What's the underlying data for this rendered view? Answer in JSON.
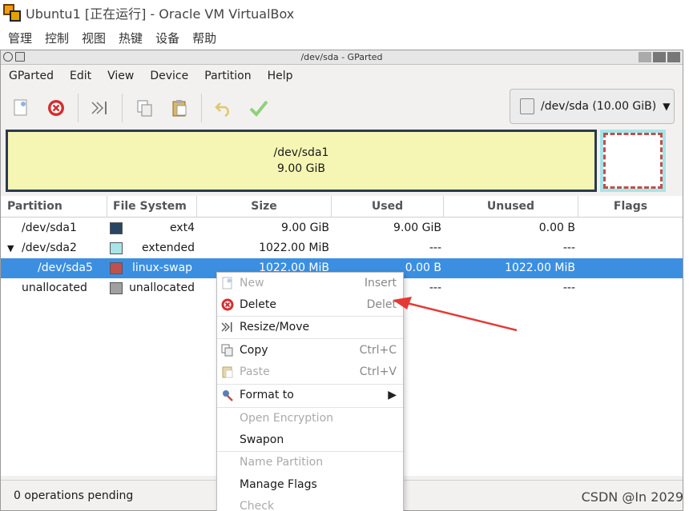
{
  "host": {
    "title": "Ubuntu1 [正在运行] - Oracle VM VirtualBox",
    "menu": [
      "管理",
      "控制",
      "视图",
      "热键",
      "设备",
      "帮助"
    ]
  },
  "guest": {
    "title": "/dev/sda - GParted",
    "menu": [
      "GParted",
      "Edit",
      "View",
      "Device",
      "Partition",
      "Help"
    ],
    "device_selector": "/dev/sda (10.00 GiB)"
  },
  "partition_bar": {
    "p1_name": "/dev/sda1",
    "p1_size": "9.00 GiB"
  },
  "table": {
    "headers": [
      "Partition",
      "File System",
      "Size",
      "Used",
      "Unused",
      "Flags"
    ],
    "rows": [
      {
        "partition": "/dev/sda1",
        "fs": "ext4",
        "size": "9.00 GiB",
        "used": "9.00 GiB",
        "unused": "0.00 B",
        "color": "#2a4564"
      },
      {
        "partition": "/dev/sda2",
        "fs": "extended",
        "size": "1022.00 MiB",
        "used": "---",
        "unused": "---",
        "color": "#a7e5e7"
      },
      {
        "partition": "/dev/sda5",
        "fs": "linux-swap",
        "size": "1022.00 MiB",
        "used": "0.00 B",
        "unused": "1022.00 MiB",
        "color": "#c0504d"
      },
      {
        "partition": "unallocated",
        "fs": "unallocated",
        "size": "",
        "used": "",
        "unused": "---",
        "color": "#a0a0a0"
      }
    ],
    "sda2_flags": "---",
    "unalloc_flags": "---",
    "unalloc_used": "---"
  },
  "status": "0 operations pending",
  "context_menu": {
    "new": "New",
    "new_acc": "Insert",
    "delete": "Delete",
    "delete_acc": "Delet",
    "resize": "Resize/Move",
    "copy": "Copy",
    "copy_acc": "Ctrl+C",
    "paste": "Paste",
    "paste_acc": "Ctrl+V",
    "format": "Format to",
    "open_enc": "Open Encryption",
    "swapon": "Swapon",
    "name_partition": "Name Partition",
    "manage_flags": "Manage Flags",
    "check": "Check"
  },
  "watermark": "CSDN @In 2029",
  "colors": {
    "selection": "#3c8fe0",
    "accent_arrow": "#e53935"
  }
}
